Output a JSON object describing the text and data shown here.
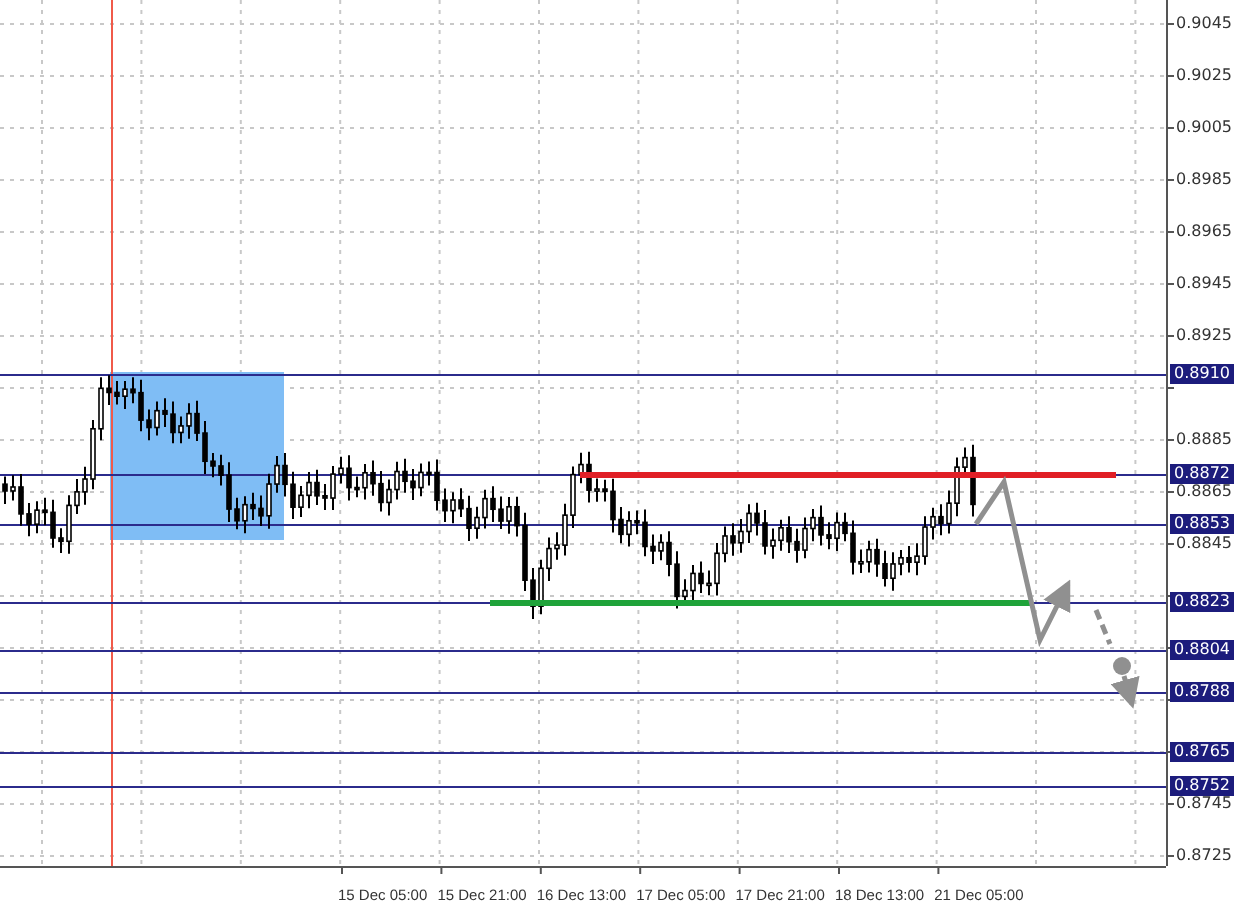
{
  "price_axis": {
    "ticks": [
      "0.9045",
      "0.9025",
      "0.9005",
      "0.8985",
      "0.8965",
      "0.8945",
      "0.8925",
      "0.8885",
      "0.8865",
      "0.8845",
      "0.8745",
      "0.8725"
    ]
  },
  "levels": [
    {
      "label": "0.8910"
    },
    {
      "label": "0.8872",
      "color": "#e01f26"
    },
    {
      "label": "0.8853"
    },
    {
      "label": "0.8823",
      "color": "#1fa33a"
    },
    {
      "label": "0.8804"
    },
    {
      "label": "0.8788"
    },
    {
      "label": "0.8765"
    },
    {
      "label": "0.8752"
    }
  ],
  "time_axis": {
    "labels": [
      "15 Dec 05:00",
      "15 Dec 21:00",
      "16 Dec 13:00",
      "17 Dec 05:00",
      "17 Dec 21:00",
      "18 Dec 13:00",
      "21 Dec 05:00"
    ]
  }
}
